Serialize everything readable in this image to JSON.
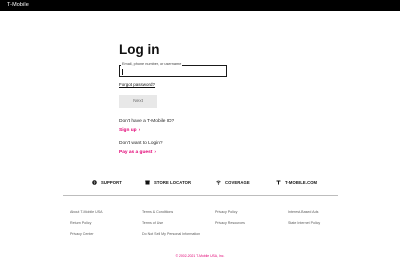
{
  "header": {
    "brand": "T-Mobile"
  },
  "login": {
    "title": "Log in",
    "field_label": "Email, phone number, or username",
    "forgot_password": "Forgot password?",
    "next_label": "Next",
    "no_id_prompt": "Don't have a T-Mobile ID?",
    "sign_up": "Sign up",
    "no_login_prompt": "Don't want to Login?",
    "pay_as_guest": "Pay as a guest",
    "chevron": "›",
    "accent_color": "#e20074"
  },
  "quick_links": [
    {
      "label": "SUPPORT",
      "icon": "support-icon"
    },
    {
      "label": "STORE LOCATOR",
      "icon": "store-icon"
    },
    {
      "label": "COVERAGE",
      "icon": "coverage-icon"
    },
    {
      "label": "T-MOBILE.COM",
      "icon": "tmobile-icon"
    }
  ],
  "footer": {
    "columns": [
      [
        "About T-Mobile USA",
        "Return Policy",
        "Privacy Center"
      ],
      [
        "Terms & Conditions",
        "Terms of Use",
        "Do Not Sell My Personal Information"
      ],
      [
        "Privacy Policy",
        "Privacy Resources"
      ],
      [
        "Interest-Based Ads",
        "State Internet Policy"
      ]
    ],
    "copyright": "© 2002-2021 T-Mobile USA, Inc."
  }
}
